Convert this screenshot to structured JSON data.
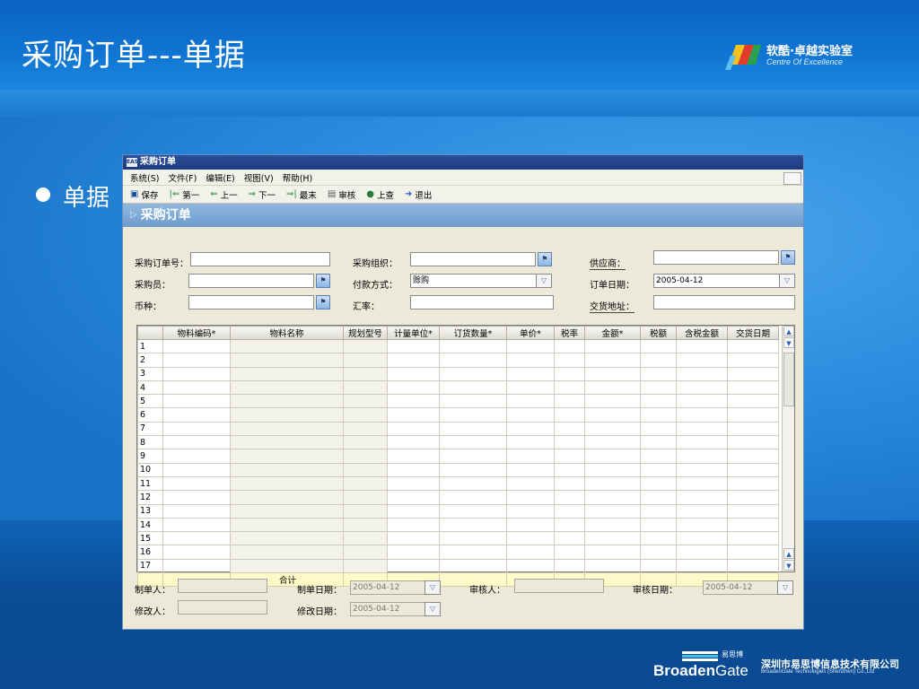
{
  "slide": {
    "title": "采购订单---单据",
    "bullet": "单据",
    "coe_logo": {
      "cn": "软酷·卓越实验室",
      "en": "Centre Of Excellence"
    },
    "company_logo": {
      "brand_a": "Broaden",
      "brand_b": "Gate",
      "cn_small": "易思博",
      "company_cn": "深圳市易思博信息技术有限公司",
      "company_en": "BroadenGate Technologies (Shenzhen) Co.,Ltd"
    },
    "colors": {
      "bg": "#1467b8",
      "title": "#ffffff"
    }
  },
  "window": {
    "title": "采购订单",
    "app_badge": "EAS",
    "menu": [
      "系统(S)",
      "文件(F)",
      "编辑(E)",
      "视图(V)",
      "帮助(H)"
    ],
    "toolbar": [
      {
        "label": "保存",
        "icon": "save-icon"
      },
      {
        "label": "第一",
        "icon": "first-icon"
      },
      {
        "label": "上一",
        "icon": "prev-icon"
      },
      {
        "label": "下一",
        "icon": "next-icon"
      },
      {
        "label": "最末",
        "icon": "last-icon"
      },
      {
        "label": "审核",
        "icon": "audit-icon"
      },
      {
        "label": "上查",
        "icon": "trace-up-icon"
      },
      {
        "label": "退出",
        "icon": "exit-icon"
      }
    ],
    "form_title": "采购订单",
    "fields": {
      "order_no": {
        "label": "采购订单号：",
        "value": ""
      },
      "purchase_org": {
        "label": "采购组织：",
        "value": ""
      },
      "supplier": {
        "label": "供应商：",
        "value": ""
      },
      "buyer": {
        "label": "采购员：",
        "value": ""
      },
      "payment": {
        "label": "付款方式：",
        "value": "赊购"
      },
      "order_date": {
        "label": "订单日期：",
        "value": "2005-04-12"
      },
      "currency": {
        "label": "币种：",
        "value": ""
      },
      "rate": {
        "label": "汇率：",
        "value": ""
      },
      "delivery_addr": {
        "label": "交货地址：",
        "value": ""
      }
    },
    "grid": {
      "columns": [
        "物料编码*",
        "物料名称",
        "规划型号",
        "计量单位*",
        "订货数量*",
        "单价*",
        "税率",
        "金额*",
        "税额",
        "含税金额",
        "交货日期"
      ],
      "rows": [
        "1",
        "2",
        "3",
        "4",
        "5",
        "6",
        "7",
        "8",
        "9",
        "10",
        "11",
        "12",
        "13",
        "14",
        "15",
        "16",
        "17"
      ],
      "total_label": "合计"
    },
    "footer": {
      "creator": {
        "label": "制单人：",
        "value": ""
      },
      "create_date": {
        "label": "制单日期：",
        "value": "2005-04-12"
      },
      "auditor": {
        "label": "审核人：",
        "value": ""
      },
      "audit_date": {
        "label": "审核日期：",
        "value": "2005-04-12"
      },
      "modifier": {
        "label": "修改人：",
        "value": ""
      },
      "modify_date": {
        "label": "修改日期：",
        "value": "2005-04-12"
      }
    }
  }
}
